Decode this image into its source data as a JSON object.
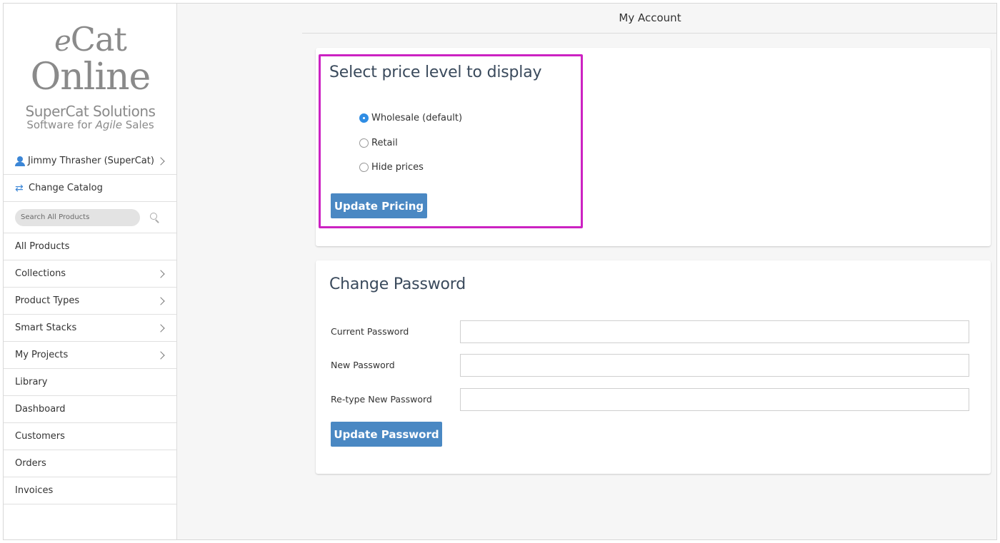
{
  "page": {
    "title": "My Account"
  },
  "logo": {
    "line1_e": "e",
    "line1_rest": "Cat",
    "line2": "Online",
    "brand": "SuperCat Solutions",
    "tagline_pre": "Software for ",
    "tagline_em": "Agile",
    "tagline_post": " Sales"
  },
  "sidebar": {
    "user": "Jimmy Thrasher (SuperCat)",
    "change_catalog": "Change Catalog",
    "search_placeholder": "Search All Products",
    "items": [
      {
        "label": "All Products",
        "has_chevron": false
      },
      {
        "label": "Collections",
        "has_chevron": true
      },
      {
        "label": "Product Types",
        "has_chevron": true
      },
      {
        "label": "Smart Stacks",
        "has_chevron": true
      },
      {
        "label": "My Projects",
        "has_chevron": true
      },
      {
        "label": "Library",
        "has_chevron": false
      },
      {
        "label": "Dashboard",
        "has_chevron": false
      },
      {
        "label": "Customers",
        "has_chevron": false
      },
      {
        "label": "Orders",
        "has_chevron": false
      },
      {
        "label": "Invoices",
        "has_chevron": false
      }
    ]
  },
  "pricing": {
    "heading": "Select price level to display",
    "options": [
      {
        "label": "Wholesale (default)",
        "selected": true
      },
      {
        "label": "Retail",
        "selected": false
      },
      {
        "label": "Hide prices",
        "selected": false
      }
    ],
    "button": "Update Pricing"
  },
  "password": {
    "heading": "Change Password",
    "fields": [
      {
        "label": "Current Password",
        "value": ""
      },
      {
        "label": "New Password",
        "value": ""
      },
      {
        "label": "Re-type New Password",
        "value": ""
      }
    ],
    "button": "Update Password"
  },
  "colors": {
    "accent": "#4a88c3",
    "highlight": "#cc22c2",
    "radio_on": "#2f8de4"
  }
}
